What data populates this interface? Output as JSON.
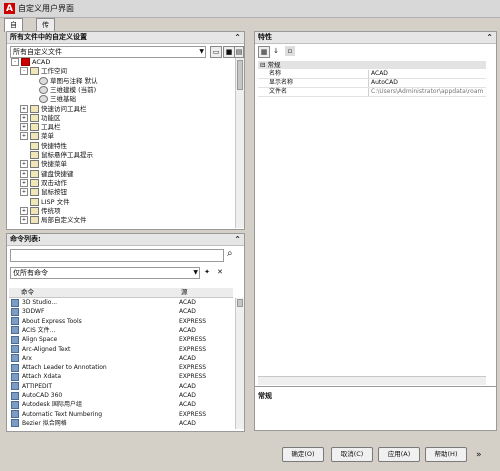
{
  "window": {
    "title": "自定义用户界面"
  },
  "tabs": [
    {
      "label": "自定义"
    },
    {
      "label": "传输"
    }
  ],
  "customizations_panel": {
    "header": "所有文件中的自定义设置",
    "dropdown_value": "所有自定义文件",
    "tree": [
      {
        "label": "ACAD",
        "level": 0,
        "expander": "-",
        "icon": "acad"
      },
      {
        "label": "工作空间",
        "level": 1,
        "expander": "-",
        "icon": "folder"
      },
      {
        "label": "草图与注释 默认",
        "level": 2,
        "icon": "gear"
      },
      {
        "label": "三维建模 (当前)",
        "level": 2,
        "icon": "gear"
      },
      {
        "label": "三维基础",
        "level": 2,
        "icon": "gear"
      },
      {
        "label": "快速访问工具栏",
        "level": 1,
        "expander": "+",
        "icon": "folder"
      },
      {
        "label": "功能区",
        "level": 1,
        "expander": "+",
        "icon": "folder"
      },
      {
        "label": "工具栏",
        "level": 1,
        "expander": "+",
        "icon": "folder"
      },
      {
        "label": "菜单",
        "level": 1,
        "expander": "+",
        "icon": "folder"
      },
      {
        "label": "快捷特性",
        "level": 1,
        "icon": "folder"
      },
      {
        "label": "鼠标悬停工具提示",
        "level": 1,
        "icon": "folder"
      },
      {
        "label": "快捷菜单",
        "level": 1,
        "expander": "+",
        "icon": "folder"
      },
      {
        "label": "键盘快捷键",
        "level": 1,
        "expander": "+",
        "icon": "folder"
      },
      {
        "label": "双击动作",
        "level": 1,
        "expander": "+",
        "icon": "folder"
      },
      {
        "label": "鼠标按钮",
        "level": 1,
        "expander": "+",
        "icon": "folder"
      },
      {
        "label": "LISP 文件",
        "level": 1,
        "icon": "folder"
      },
      {
        "label": "传统项",
        "level": 1,
        "expander": "+",
        "icon": "folder"
      },
      {
        "label": "局部自定义文件",
        "level": 1,
        "expander": "+",
        "icon": "folder"
      }
    ]
  },
  "command_panel": {
    "header": "命令列表:",
    "filter_value": "仅所有命令",
    "columns": {
      "command": "命令",
      "source": "源"
    },
    "commands": [
      {
        "name": "3D Studio...",
        "source": "ACAD"
      },
      {
        "name": "3DDWF",
        "source": "ACAD"
      },
      {
        "name": "About Express Tools",
        "source": "EXPRESS"
      },
      {
        "name": "ACIS 文件...",
        "source": "ACAD"
      },
      {
        "name": "Align Space",
        "source": "EXPRESS"
      },
      {
        "name": "Arc-Aligned Text",
        "source": "EXPRESS"
      },
      {
        "name": "Arx",
        "source": "ACAD"
      },
      {
        "name": "Attach Leader to Annotation",
        "source": "EXPRESS"
      },
      {
        "name": "Attach Xdata",
        "source": "EXPRESS"
      },
      {
        "name": "ATTIPEDIT",
        "source": "ACAD"
      },
      {
        "name": "AutoCAD 360",
        "source": "ACAD"
      },
      {
        "name": "Autodesk 国际用户组",
        "source": "ACAD"
      },
      {
        "name": "Automatic Text Numbering",
        "source": "EXPRESS"
      },
      {
        "name": "Bezier 拟合网格",
        "source": "ACAD"
      }
    ]
  },
  "properties_panel": {
    "header": "特性",
    "section": "常规",
    "rows": [
      {
        "key": "名称",
        "value": "ACAD"
      },
      {
        "key": "显示名称",
        "value": "AutoCAD"
      },
      {
        "key": "文件名",
        "value": "C:\\Users\\Administrator\\appdata\\roam"
      }
    ],
    "description_title": "常规"
  },
  "buttons": {
    "ok": "确定(O)",
    "cancel": "取消(C)",
    "apply": "应用(A)",
    "help": "帮助(H)"
  }
}
